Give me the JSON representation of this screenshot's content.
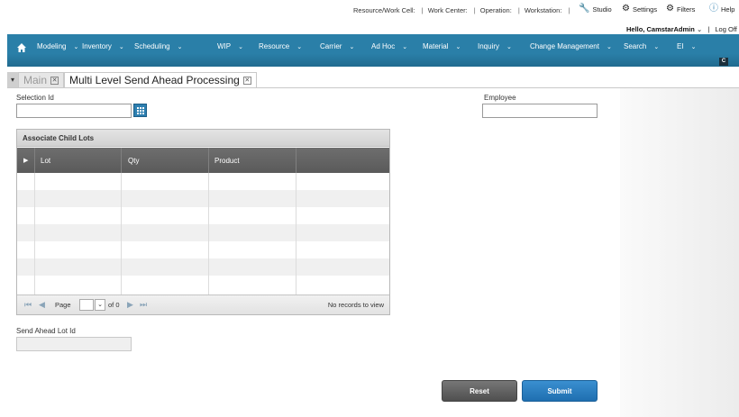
{
  "header": {
    "context": [
      "Resource/Work Cell:",
      "Work Center:",
      "Operation:",
      "Workstation:"
    ],
    "tools": {
      "studio": "Studio",
      "settings": "Settings",
      "filters": "Filters",
      "help": "Help"
    },
    "greeting": "Hello, CamstarAdmin",
    "logoff": "Log Off"
  },
  "nav": {
    "items": [
      "Modeling",
      "Inventory",
      "Scheduling",
      "WIP",
      "Resource",
      "Carrier",
      "Ad Hoc",
      "Material",
      "Inquiry",
      "Change Management",
      "Search",
      "EI"
    ],
    "badge": "C"
  },
  "tabs": [
    {
      "label": "Main"
    },
    {
      "label": "Multi Level Send Ahead Processing"
    }
  ],
  "form": {
    "selection_id_label": "Selection Id",
    "employee_label": "Employee",
    "send_ahead_label": "Send Ahead Lot Id"
  },
  "grid": {
    "title": "Associate Child Lots",
    "columns": [
      "Lot",
      "Qty",
      "Product"
    ],
    "pager": {
      "page_label": "Page",
      "of_label": "of 0",
      "status": "No records to view"
    }
  },
  "actions": {
    "reset": "Reset",
    "submit": "Submit"
  },
  "colors": {
    "nav": "#2a7fa8",
    "submit": "#2a7fc0",
    "reset": "#5e5e5e"
  }
}
